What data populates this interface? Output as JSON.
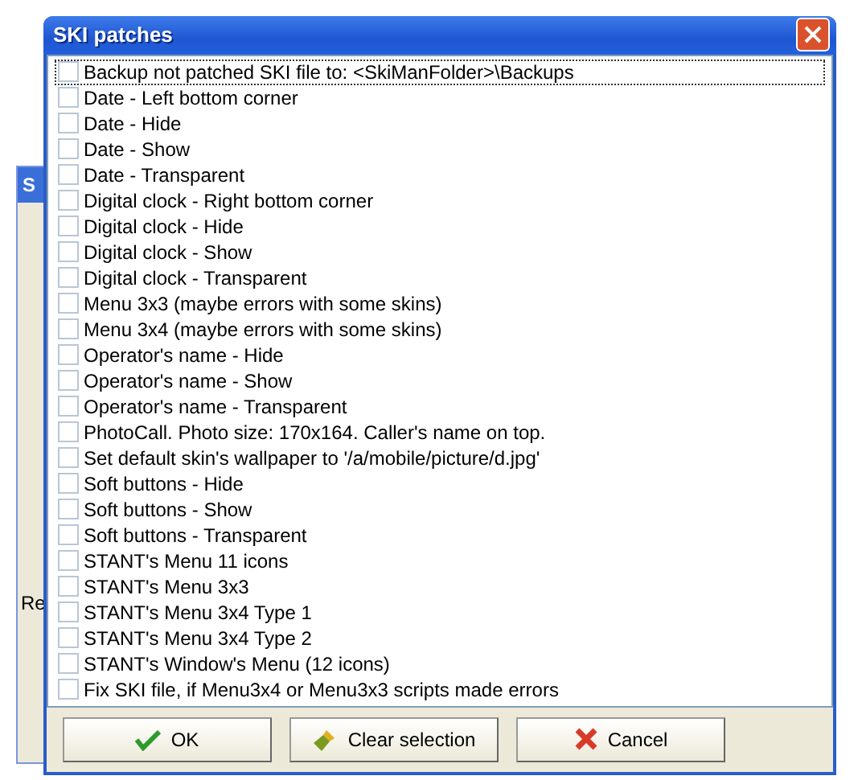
{
  "background_window": {
    "title": "S",
    "status_text": "Re"
  },
  "window": {
    "title": "SKI patches"
  },
  "patches": [
    {
      "label": "Backup not patched SKI file to: <SkiManFolder>\\Backups",
      "checked": false,
      "focused": true
    },
    {
      "label": "Date - Left bottom corner",
      "checked": false,
      "focused": false
    },
    {
      "label": "Date - Hide",
      "checked": false,
      "focused": false
    },
    {
      "label": "Date - Show",
      "checked": false,
      "focused": false
    },
    {
      "label": "Date - Transparent",
      "checked": false,
      "focused": false
    },
    {
      "label": "Digital clock - Right bottom corner",
      "checked": false,
      "focused": false
    },
    {
      "label": "Digital clock - Hide",
      "checked": false,
      "focused": false
    },
    {
      "label": "Digital clock - Show",
      "checked": false,
      "focused": false
    },
    {
      "label": "Digital clock - Transparent",
      "checked": false,
      "focused": false
    },
    {
      "label": "Menu 3x3 (maybe errors with some skins)",
      "checked": false,
      "focused": false
    },
    {
      "label": "Menu 3x4 (maybe errors with some skins)",
      "checked": false,
      "focused": false
    },
    {
      "label": "Operator's name - Hide",
      "checked": false,
      "focused": false
    },
    {
      "label": "Operator's name - Show",
      "checked": false,
      "focused": false
    },
    {
      "label": "Operator's name - Transparent",
      "checked": false,
      "focused": false
    },
    {
      "label": "PhotoCall. Photo size: 170x164. Caller's name on top.",
      "checked": false,
      "focused": false
    },
    {
      "label": "Set default skin's wallpaper to '/a/mobile/picture/d.jpg'",
      "checked": false,
      "focused": false
    },
    {
      "label": "Soft buttons - Hide",
      "checked": false,
      "focused": false
    },
    {
      "label": "Soft buttons - Show",
      "checked": false,
      "focused": false
    },
    {
      "label": "Soft buttons - Transparent",
      "checked": false,
      "focused": false
    },
    {
      "label": "STANT's Menu 11 icons",
      "checked": false,
      "focused": false
    },
    {
      "label": "STANT's Menu 3x3",
      "checked": false,
      "focused": false
    },
    {
      "label": "STANT's Menu 3x4 Type 1",
      "checked": false,
      "focused": false
    },
    {
      "label": "STANT's Menu 3x4 Type 2",
      "checked": false,
      "focused": false
    },
    {
      "label": "STANT's Window's Menu (12 icons)",
      "checked": false,
      "focused": false
    },
    {
      "label": "Fix SKI file, if Menu3x4 or Menu3x3 scripts made errors",
      "checked": false,
      "focused": false
    }
  ],
  "buttons": [
    {
      "label": "OK",
      "kind": "ok"
    },
    {
      "label": "Clear selection",
      "kind": "clear"
    },
    {
      "label": "Cancel",
      "kind": "cancel"
    }
  ]
}
